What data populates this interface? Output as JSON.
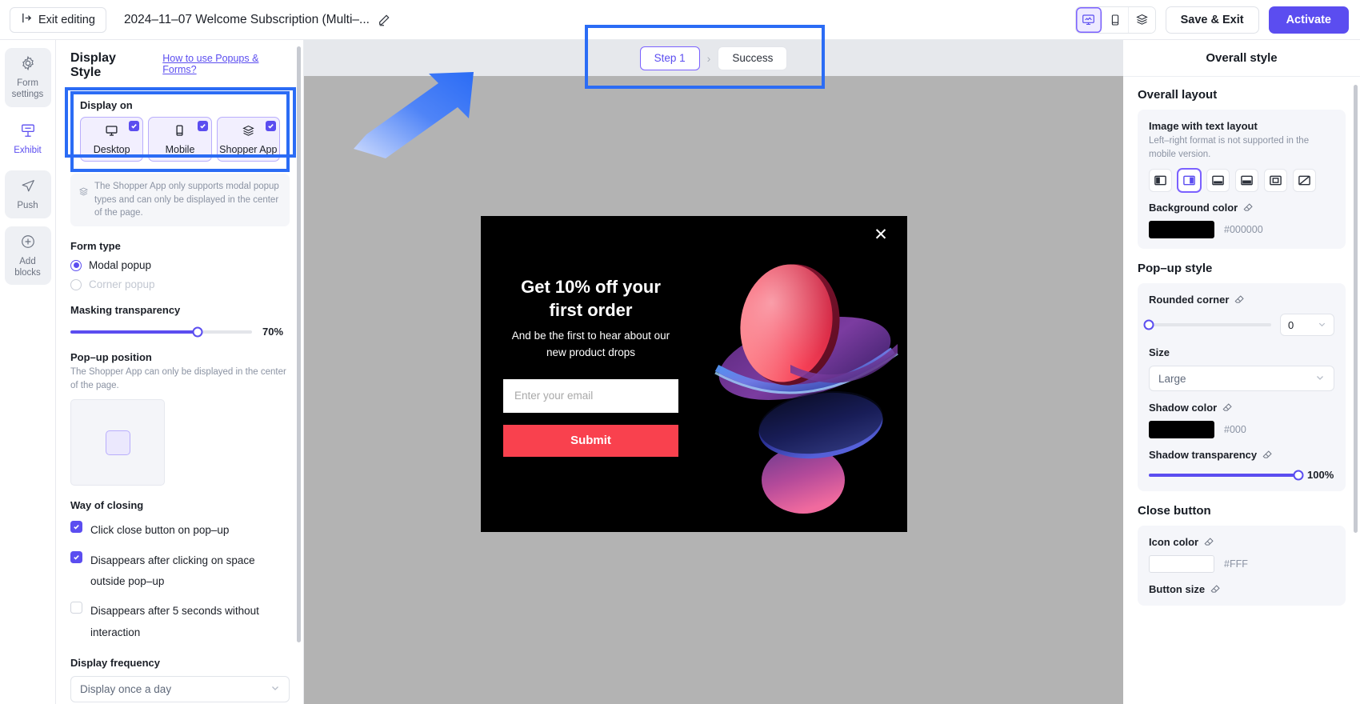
{
  "topbar": {
    "exit_label": "Exit editing",
    "doc_title": "2024–11–07 Welcome Subscription (Multi–...",
    "save_label": "Save & Exit",
    "activate_label": "Activate",
    "view_buttons": [
      "desktop-preview-icon",
      "mobile-preview-icon",
      "shopper-app-preview-icon"
    ]
  },
  "rail": {
    "items": [
      {
        "label": "Form settings",
        "icon": "gear-icon"
      },
      {
        "label": "Exhibit",
        "icon": "exhibit-icon"
      },
      {
        "label": "Push",
        "icon": "send-icon"
      },
      {
        "label": "Add blocks",
        "icon": "plus-circle-icon"
      }
    ]
  },
  "left_panel": {
    "title": "Display Style",
    "help_link": "How to use Popups & Forms?",
    "display_on": {
      "label": "Display on",
      "devices": [
        {
          "label": "Desktop",
          "icon": "monitor-icon",
          "checked": true
        },
        {
          "label": "Mobile",
          "icon": "phone-icon",
          "checked": true
        },
        {
          "label": "Shopper App",
          "icon": "shopper-app-icon",
          "checked": true
        }
      ],
      "note": "The Shopper App only supports modal popup types and can only be displayed in the center of the page."
    },
    "form_type": {
      "label": "Form type",
      "options": [
        {
          "label": "Modal popup",
          "selected": true,
          "disabled": false
        },
        {
          "label": "Corner popup",
          "selected": false,
          "disabled": true
        }
      ]
    },
    "masking": {
      "label": "Masking transparency",
      "value": "70%",
      "percent": 70
    },
    "position": {
      "label": "Pop–up position",
      "note": "The Shopper App can only be displayed in the center of the page."
    },
    "closing": {
      "label": "Way of closing",
      "options": [
        {
          "label": "Click close button on pop–up",
          "checked": true
        },
        {
          "label": "Disappears after clicking on space outside pop–up",
          "checked": true
        },
        {
          "label": "Disappears after 5 seconds without interaction",
          "checked": false
        }
      ]
    },
    "frequency": {
      "label": "Display frequency",
      "value": "Display once a day"
    }
  },
  "canvas": {
    "steps": [
      {
        "label": "Step 1",
        "active": true
      },
      {
        "label": "Success",
        "active": false
      }
    ],
    "step_separator": "›",
    "popup": {
      "heading": "Get 10% off your first order",
      "subheading": "And be the first to hear about  our new product drops",
      "email_placeholder": "Enter your email",
      "email_value": "",
      "submit_label": "Submit",
      "close_icon": "close-x-icon",
      "submit_color": "#f9414e",
      "background_color": "#000000"
    }
  },
  "right_panel": {
    "title": "Overall style",
    "overall_layout": {
      "title": "Overall layout",
      "card_label": "Image with text layout",
      "card_note": "Left–right format is not supported in the mobile version.",
      "layouts": [
        {
          "name": "image-left-layout",
          "active": false
        },
        {
          "name": "image-right-layout",
          "active": true
        },
        {
          "name": "image-top-layout",
          "active": false
        },
        {
          "name": "image-bottom-layout",
          "active": false
        },
        {
          "name": "image-background-layout",
          "active": false
        },
        {
          "name": "no-image-layout",
          "active": false
        }
      ],
      "background_color_label": "Background color",
      "background_color": "#000000"
    },
    "popup_style": {
      "title": "Pop–up style",
      "rounded_corner_label": "Rounded corner",
      "rounded_corner_value": "0",
      "rounded_corner_percent": 0,
      "size_label": "Size",
      "size_value": "Large",
      "shadow_color_label": "Shadow color",
      "shadow_color": "#000",
      "shadow_transparency_label": "Shadow transparency",
      "shadow_transparency_value": "100%",
      "shadow_transparency_percent": 100
    },
    "close_button": {
      "title": "Close button",
      "icon_color_label": "Icon color",
      "icon_color": "#FFF",
      "button_size_label": "Button size"
    }
  },
  "theme": {
    "accent": "#5b4df0",
    "annotation": "#2b6cf5",
    "canvas_bg": "#b3b3b3"
  }
}
